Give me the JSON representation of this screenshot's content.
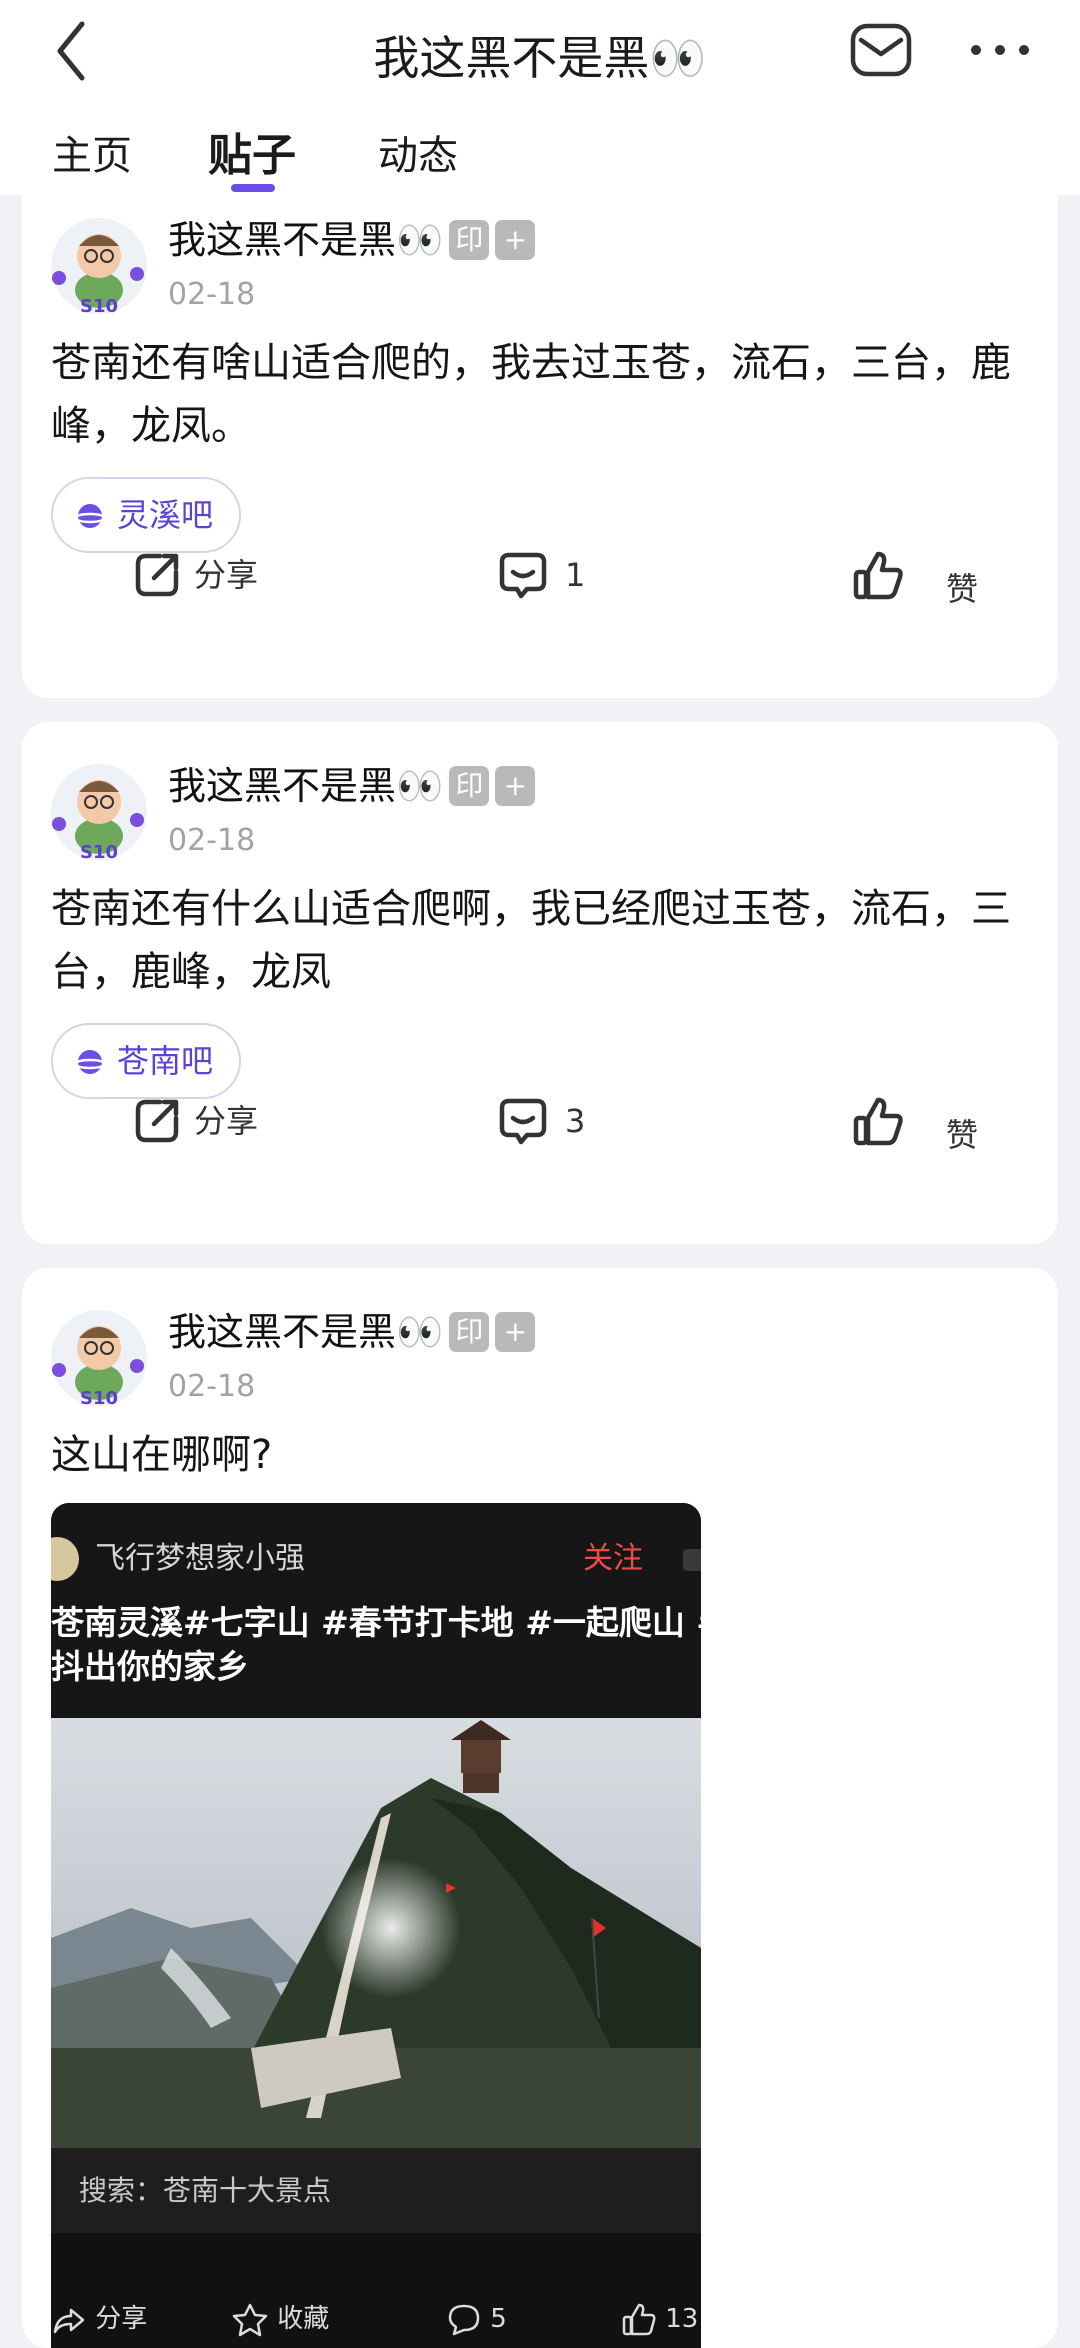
{
  "header": {
    "title": "我这黑不是黑👀",
    "tabs": [
      "主页",
      "贴子",
      "动态"
    ],
    "active_tab": "贴子"
  },
  "badges": {
    "print": "印",
    "plus": "+"
  },
  "posts": [
    {
      "author": "我这黑不是黑👀",
      "avatar_tag": "S10",
      "date": "02-18",
      "text": "苍南还有啥山适合爬的，我去过玉苍，流石，三台，鹿峰，龙凤。",
      "forum": "灵溪吧",
      "share_label": "分享",
      "comment_count": "1",
      "like_label": "赞"
    },
    {
      "author": "我这黑不是黑👀",
      "avatar_tag": "S10",
      "date": "02-18",
      "text": "苍南还有什么山适合爬啊，我已经爬过玉苍，流石，三台，鹿峰，龙凤",
      "forum": "苍南吧",
      "share_label": "分享",
      "comment_count": "3",
      "like_label": "赞"
    },
    {
      "author": "我这黑不是黑👀",
      "avatar_tag": "S10",
      "date": "02-18",
      "text": "这山在哪啊?",
      "embed": {
        "user": "飞行梦想家小强",
        "follow_label": "关注",
        "tags_line1": "苍南灵溪#七字山 #春节打卡地 #一起爬山 #",
        "tags_line2": "抖出你的家乡",
        "search": "搜索：苍南十大景点",
        "share_label": "分享",
        "fav_label": "收藏",
        "comment_count": "5",
        "like_count": "13"
      }
    }
  ],
  "colors": {
    "accent": "#6c4de6",
    "background": "#f2f1f6",
    "follow_red": "#f04a4a"
  },
  "icons": [
    "back-icon",
    "mail-icon",
    "more-icon",
    "share-icon",
    "comment-icon",
    "like-icon",
    "planet-icon",
    "search-icon",
    "star-icon"
  ]
}
